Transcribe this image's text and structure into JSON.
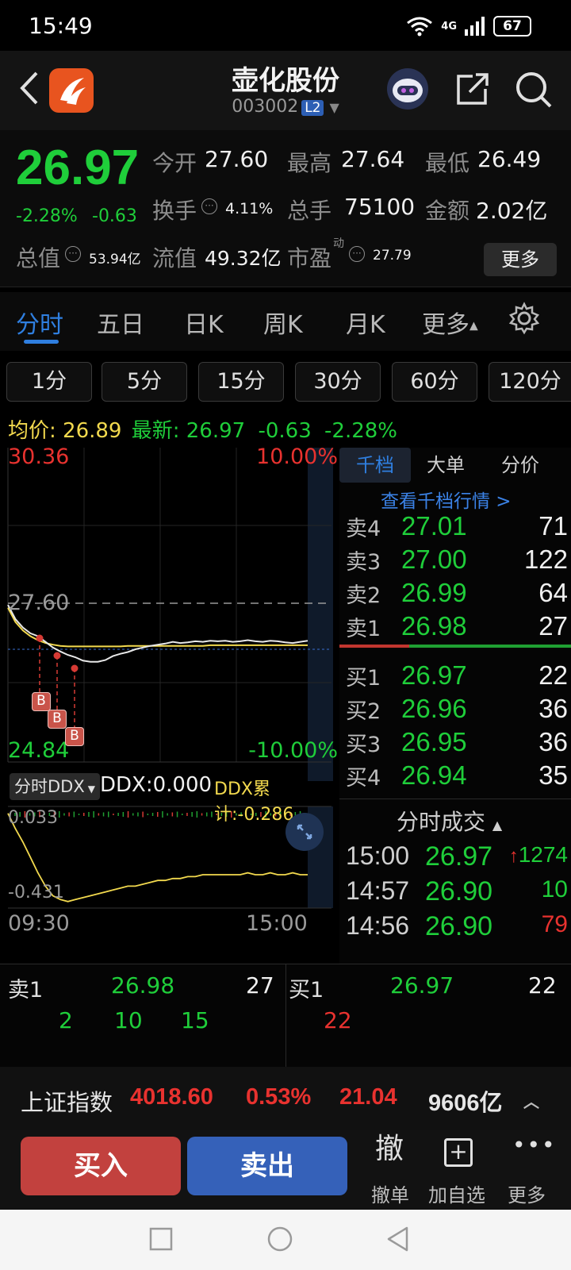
{
  "status": {
    "time": "15:49",
    "network": "4G",
    "battery": "67"
  },
  "header": {
    "name": "壶化股份",
    "code": "003002",
    "level": "L2"
  },
  "quote": {
    "price": "26.97",
    "pct": "-2.28%",
    "chg": "-0.63",
    "open_label": "今开",
    "open": "27.60",
    "high_label": "最高",
    "high": "27.64",
    "low_label": "最低",
    "low": "26.49",
    "turnover_label": "换手",
    "turnover": "4.11%",
    "volume_label": "总手",
    "volume": "75100",
    "amount_label": "金额",
    "amount": "2.02亿",
    "mcap_label": "总值",
    "mcap": "53.94亿",
    "float_label": "流值",
    "float": "49.32亿",
    "pe_label": "市盈",
    "pe_sup": "动",
    "pe": "27.79",
    "more": "更多"
  },
  "period_tabs": [
    "分时",
    "五日",
    "日K",
    "周K",
    "月K",
    "更多"
  ],
  "minute_buttons": [
    "1分",
    "5分",
    "15分",
    "30分",
    "60分",
    "120分"
  ],
  "avg": {
    "avg_label": "均价:",
    "avg": "26.89",
    "latest_label": "最新:",
    "latest": "26.97",
    "chg": "-0.63",
    "pct": "-2.28%"
  },
  "chart": {
    "y_top": "30.36",
    "y_top_pct": "10.00%",
    "ref": "27.60",
    "y_bottom": "24.84",
    "y_bottom_pct": "-10.00%",
    "x_start": "09:30",
    "x_end": "15:00",
    "markers": [
      "B",
      "B",
      "B"
    ],
    "ddx_selector": "分时DDX",
    "ddx": "DDX:0.000",
    "ddx_cum": "DDX累计:-0.286",
    "ddx_top": "0.033",
    "ddx_bottom": "-0.431",
    "price_line": [
      27.6,
      27.35,
      27.2,
      27.1,
      27.05,
      26.95,
      26.85,
      26.78,
      26.72,
      26.68,
      26.62,
      26.6,
      26.6,
      26.63,
      26.7,
      26.74,
      26.77,
      26.82,
      26.85,
      26.88,
      26.9,
      26.92,
      26.95,
      26.93,
      26.94,
      26.96,
      26.95,
      26.97,
      26.96,
      26.97,
      26.95,
      26.96,
      26.98,
      26.96,
      26.95,
      26.97,
      26.96,
      26.94,
      26.93,
      26.95,
      26.97
    ],
    "avg_line": [
      27.55,
      27.3,
      27.15,
      27.05,
      26.98,
      26.93,
      26.9,
      26.88,
      26.87,
      26.87,
      26.87,
      26.87,
      26.87,
      26.87,
      26.87,
      26.87,
      26.88,
      26.88,
      26.88,
      26.88,
      26.88,
      26.88,
      26.88,
      26.88,
      26.88,
      26.88,
      26.88,
      26.89,
      26.89,
      26.89,
      26.89,
      26.89,
      26.89,
      26.89,
      26.89,
      26.89,
      26.89,
      26.89,
      26.89,
      26.89,
      26.89
    ],
    "ddx_line": [
      0.03,
      -0.05,
      -0.12,
      -0.2,
      -0.28,
      -0.35,
      -0.4,
      -0.42,
      -0.43,
      -0.42,
      -0.41,
      -0.4,
      -0.39,
      -0.38,
      -0.37,
      -0.36,
      -0.35,
      -0.35,
      -0.34,
      -0.33,
      -0.32,
      -0.32,
      -0.31,
      -0.31,
      -0.3,
      -0.3,
      -0.29,
      -0.29,
      -0.29,
      -0.29,
      -0.29,
      -0.29,
      -0.28,
      -0.29,
      -0.29,
      -0.28,
      -0.29,
      -0.29,
      -0.28,
      -0.29,
      -0.29
    ]
  },
  "right_tabs": [
    "千档",
    "大单",
    "分价"
  ],
  "right_link": "查看千档行情 >",
  "asks": [
    {
      "label": "卖4",
      "price": "27.01",
      "vol": "71"
    },
    {
      "label": "卖3",
      "price": "27.00",
      "vol": "122"
    },
    {
      "label": "卖2",
      "price": "26.99",
      "vol": "64"
    },
    {
      "label": "卖1",
      "price": "26.98",
      "vol": "27"
    }
  ],
  "bids": [
    {
      "label": "买1",
      "price": "26.97",
      "vol": "22"
    },
    {
      "label": "买2",
      "price": "26.96",
      "vol": "36"
    },
    {
      "label": "买3",
      "price": "26.95",
      "vol": "36"
    },
    {
      "label": "买4",
      "price": "26.94",
      "vol": "35"
    }
  ],
  "trades_title": "分时成交",
  "trades": [
    {
      "time": "15:00",
      "price": "26.97",
      "arrow": "↑",
      "vol": "1274"
    },
    {
      "time": "14:57",
      "price": "26.90",
      "arrow": "",
      "vol": "10"
    },
    {
      "time": "14:56",
      "price": "26.90",
      "arrow": "",
      "vol": "79"
    }
  ],
  "queue": {
    "sell_label": "卖1",
    "sell_price": "26.98",
    "sell_vol": "27",
    "buy_label": "买1",
    "buy_price": "26.97",
    "buy_vol": "22",
    "sell_orders": [
      "2",
      "10",
      "15"
    ],
    "buy_orders": [
      "22"
    ]
  },
  "index": {
    "name": "上证指数",
    "value": "4018.60",
    "pct": "0.53%",
    "chg": "21.04",
    "amount": "9606亿"
  },
  "actions": {
    "buy": "买入",
    "sell": "卖出",
    "cancel_glyph": "撤",
    "cancel": "撤单",
    "add": "加自选",
    "more": "更多"
  }
}
